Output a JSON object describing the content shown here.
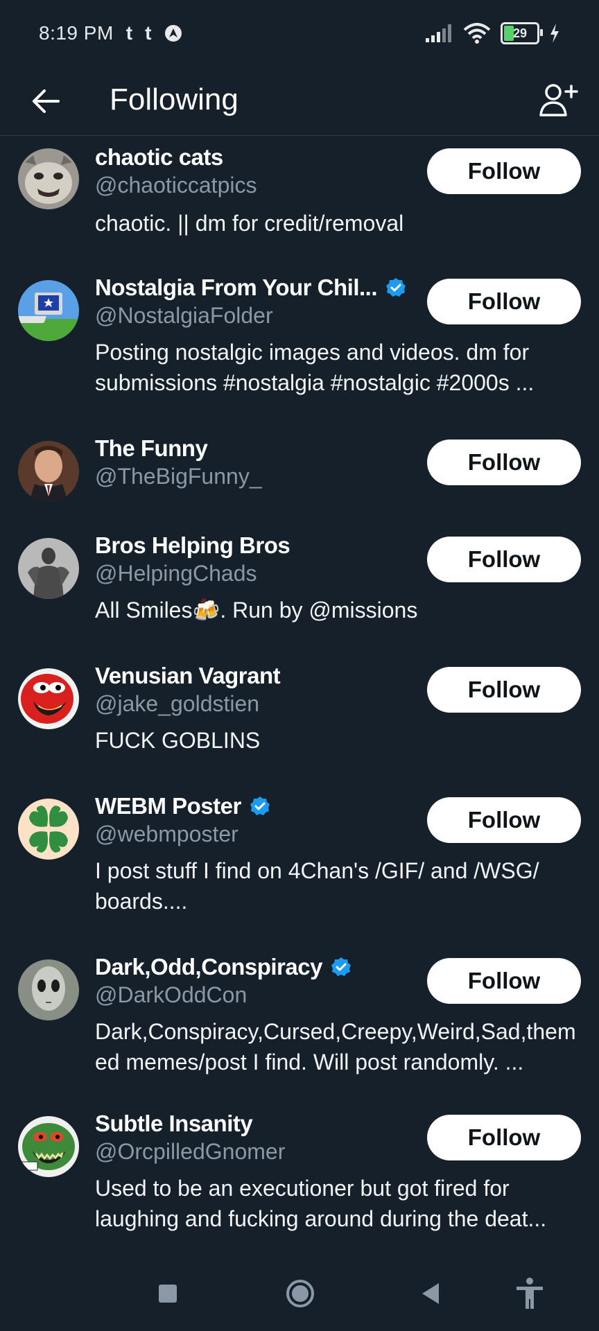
{
  "status_bar": {
    "time": "8:19 PM",
    "app_icons": [
      "t",
      "t"
    ],
    "battery": "29"
  },
  "header": {
    "title": "Following",
    "back_icon": "arrow-left-icon",
    "add_icon": "add-user-icon"
  },
  "accounts": [
    {
      "name": "chaotic cats",
      "verified": false,
      "handle": "@chaoticcatpics",
      "bio": "chaotic. ||  dm for credit/removal",
      "button": "Follow"
    },
    {
      "name": "Nostalgia From Your Chil...",
      "verified": true,
      "handle": "@NostalgiaFolder",
      "bio": "Posting nostalgic images and videos. dm for submissions #nostalgia #nostalgic #2000s ...",
      "button": "Follow"
    },
    {
      "name": "The Funny",
      "verified": false,
      "handle": "@TheBigFunny_",
      "bio": "",
      "button": "Follow"
    },
    {
      "name": "Bros Helping Bros",
      "verified": false,
      "handle": "@HelpingChads",
      "bio": "All Smiles🍻. Run by @missions",
      "button": "Follow"
    },
    {
      "name": "Venusian Vagrant",
      "verified": false,
      "handle": "@jake_goldstien",
      "bio": "FUCK GOBLINS",
      "button": "Follow"
    },
    {
      "name": "WEBM Poster",
      "verified": true,
      "handle": "@webmposter",
      "bio": "I post stuff I find on 4Chan's /GIF/ and /WSG/ boards....",
      "button": "Follow"
    },
    {
      "name": "Dark,Odd,Conspiracy",
      "verified": true,
      "handle": "@DarkOddCon",
      "bio": "Dark,Conspiracy,Cursed,Creepy,Weird,Sad,themed memes/post I find. Will post randomly. ...",
      "button": "Follow"
    },
    {
      "name": "Subtle Insanity",
      "verified": false,
      "handle": "@OrcpilledGnomer",
      "bio": "Used to be an executioner but got fired for laughing and fucking around during the deat...",
      "button": "Follow"
    }
  ],
  "colors": {
    "background": "#15202b",
    "handle": "#8b98a5",
    "verified": "#1d9bf0",
    "button_bg": "#ffffff"
  },
  "nav_bar": [
    "recents-square-icon",
    "home-circle-icon",
    "back-triangle-icon",
    "accessibility-icon"
  ]
}
